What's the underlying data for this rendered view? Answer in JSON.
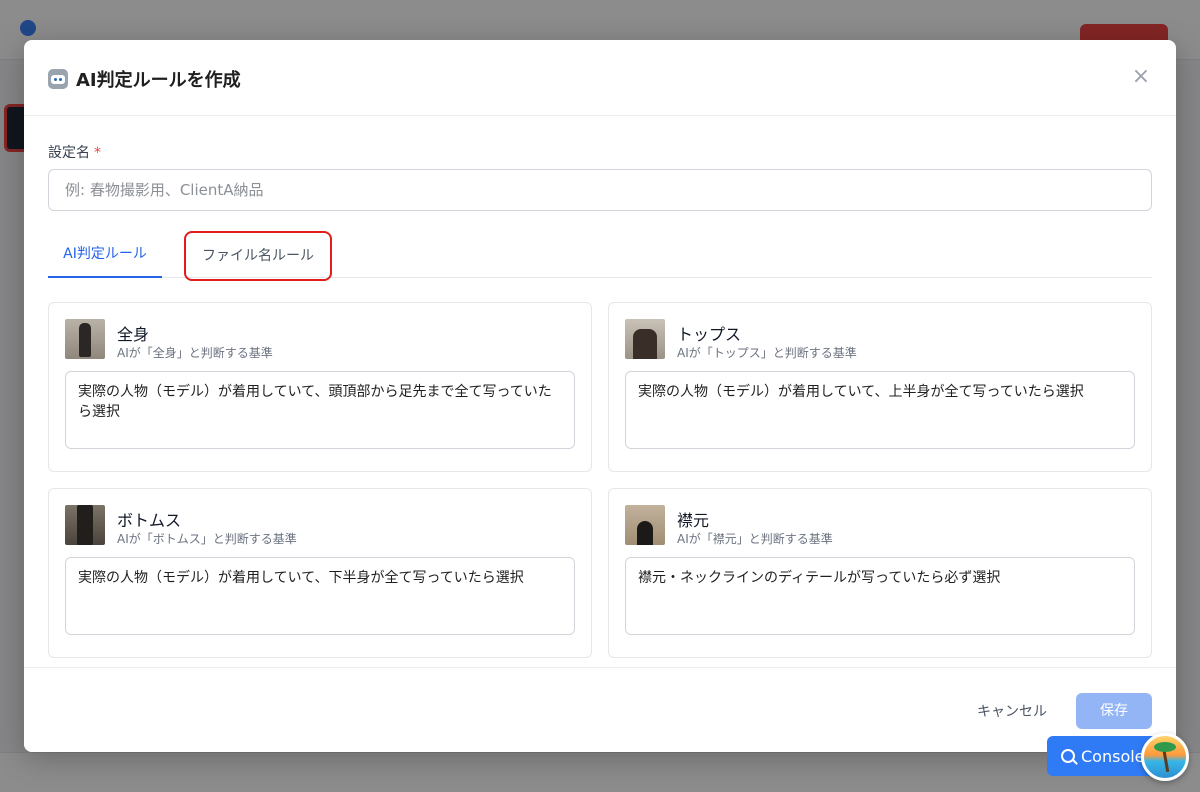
{
  "modal": {
    "title": "AI判定ルールを作成",
    "title_icon": "robot-icon",
    "close_label": "×"
  },
  "form": {
    "name_label": "設定名",
    "required_mark": "*",
    "name_placeholder": "例: 春物撮影用、ClientA納品",
    "name_value": ""
  },
  "tabs": [
    {
      "label": "AI判定ルール",
      "active": true
    },
    {
      "label": "ファイル名ルール",
      "active": false
    }
  ],
  "rules": [
    {
      "title": "全身",
      "subtitle": "AIが「全身」と判断する基準",
      "text": "実際の人物（モデル）が着用していて、頭頂部から足先まで全て写っていたら選択"
    },
    {
      "title": "トップス",
      "subtitle": "AIが「トップス」と判断する基準",
      "text": "実際の人物（モデル）が着用していて、上半身が全て写っていたら選択"
    },
    {
      "title": "ボトムス",
      "subtitle": "AIが「ボトムス」と判断する基準",
      "text": "実際の人物（モデル）が着用していて、下半身が全て写っていたら選択"
    },
    {
      "title": "襟元",
      "subtitle": "AIが「襟元」と判断する基準",
      "text": "襟元・ネックラインのディテールが写っていたら必ず選択"
    }
  ],
  "footer": {
    "cancel_label": "キャンセル",
    "save_label": "保存"
  },
  "console": {
    "label": "Console"
  },
  "colors": {
    "accent": "#2563eb",
    "highlight_border": "#e11d1d",
    "save_disabled": "#93b4f5",
    "console_button": "#2f7bf6"
  }
}
